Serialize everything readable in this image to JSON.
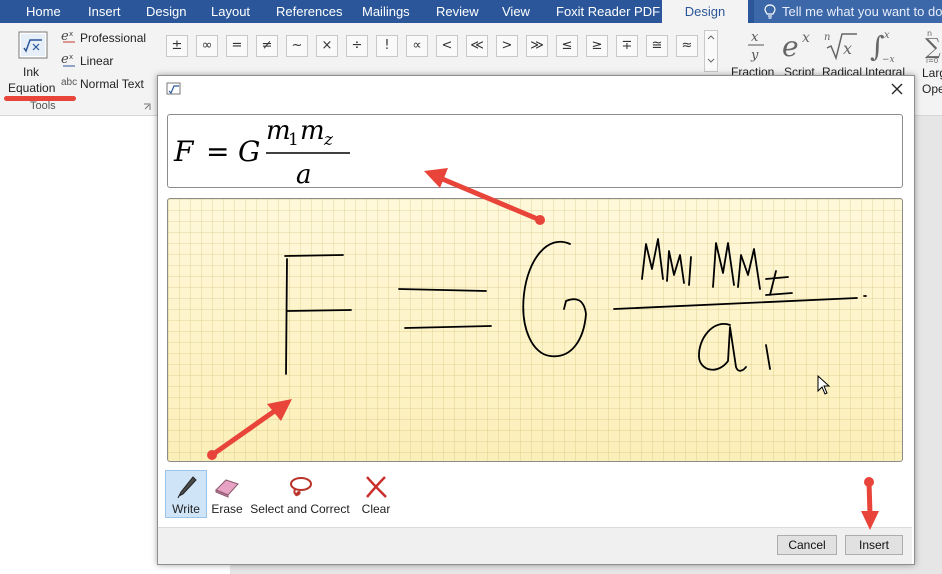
{
  "ribbon": {
    "tabs": [
      "Home",
      "Insert",
      "Design",
      "Layout",
      "References",
      "Mailings",
      "Review",
      "View",
      "Foxit Reader PDF",
      "Design"
    ],
    "active_tab": "Design",
    "tell_me": "Tell me what you want to do...",
    "tools_group": {
      "ink_equation_label_1": "Ink",
      "ink_equation_label_2": "Equation",
      "professional": "Professional",
      "linear": "Linear",
      "normal_text": "Normal Text",
      "normal_text_prefix": "abc",
      "group_label": "Tools"
    },
    "symbols_row1": [
      "±",
      "∞",
      "=",
      "≠",
      "~",
      "×",
      "÷",
      "!",
      "∝",
      "<",
      "≪",
      ">",
      "≫",
      "≤",
      "≥",
      "∓",
      "≅",
      "≈"
    ],
    "structures": [
      "Fraction",
      "Script",
      "Radical",
      "Integral",
      "Large Operator"
    ]
  },
  "dialog": {
    "equation_preview": {
      "lhs": "F",
      "equals": "=",
      "coefficient": "G",
      "numerator_1": "m",
      "sub_1": "1",
      "numerator_2": "m",
      "sub_2": "z",
      "denominator": "a"
    },
    "tools": [
      "Write",
      "Erase",
      "Select and Correct",
      "Clear"
    ],
    "active_tool": "Write",
    "buttons": {
      "cancel": "Cancel",
      "insert": "Insert"
    }
  },
  "colors": {
    "ribbon_blue": "#2b579a",
    "annotation_red": "#e8443a",
    "ink_pad": "#fdf3c6"
  }
}
